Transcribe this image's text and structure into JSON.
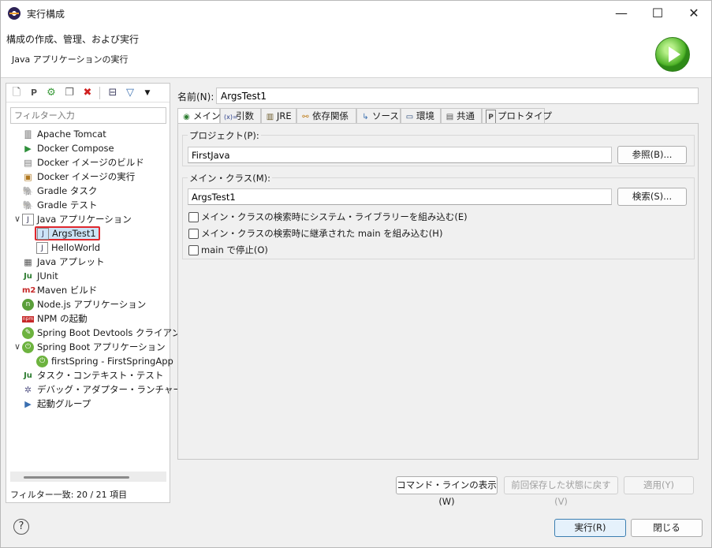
{
  "window": {
    "title": "実行構成"
  },
  "header": {
    "title": "構成の作成、管理、および実行",
    "subtitle": "Java アプリケーションの実行"
  },
  "left": {
    "filter_placeholder": "フィルター入力",
    "status": "フィルター一致: 20 / 21 項目",
    "tree": [
      {
        "label": "Apache Tomcat",
        "icon": "tomcat-icon"
      },
      {
        "label": "Docker Compose",
        "icon": "docker-compose-icon"
      },
      {
        "label": "Docker イメージのビルド",
        "icon": "docker-build-icon"
      },
      {
        "label": "Docker イメージの実行",
        "icon": "docker-run-icon"
      },
      {
        "label": "Gradle タスク",
        "icon": "gradle-icon"
      },
      {
        "label": "Gradle テスト",
        "icon": "gradle-test-icon"
      },
      {
        "label": "Java アプリケーション",
        "icon": "java-app-icon"
      },
      {
        "label": "ArgsTest1",
        "icon": "java-class-icon"
      },
      {
        "label": "HelloWorld",
        "icon": "java-class-icon"
      },
      {
        "label": "Java アプレット",
        "icon": "java-applet-icon"
      },
      {
        "label": "JUnit",
        "icon": "junit-icon"
      },
      {
        "label": "Maven ビルド",
        "icon": "maven-icon"
      },
      {
        "label": "Node.js アプリケーション",
        "icon": "nodejs-icon"
      },
      {
        "label": "NPM の起動",
        "icon": "npm-icon"
      },
      {
        "label": "Spring Boot Devtools クライアン",
        "icon": "spring-devtools-icon"
      },
      {
        "label": "Spring Boot アプリケーション",
        "icon": "spring-boot-icon"
      },
      {
        "label": "firstSpring - FirstSpringApp",
        "icon": "spring-app-icon"
      },
      {
        "label": "タスク・コンテキスト・テスト",
        "icon": "task-context-test-icon"
      },
      {
        "label": "デバッグ・アダプター・ランチャー",
        "icon": "debug-adapter-icon"
      },
      {
        "label": "起動グループ",
        "icon": "launch-group-icon"
      }
    ]
  },
  "right": {
    "name_label": "名前(N):",
    "name_value": "ArgsTest1",
    "tabs": [
      {
        "label": "メイン",
        "icon": "main-tab-icon"
      },
      {
        "label": "引数",
        "icon": "arguments-tab-icon"
      },
      {
        "label": "JRE",
        "icon": "jre-tab-icon"
      },
      {
        "label": "依存関係",
        "icon": "dependencies-tab-icon"
      },
      {
        "label": "ソース",
        "icon": "source-tab-icon"
      },
      {
        "label": "環境",
        "icon": "environment-tab-icon"
      },
      {
        "label": "共通",
        "icon": "common-tab-icon"
      },
      {
        "label": "プロトタイプ",
        "icon": "prototype-tab-icon"
      }
    ],
    "project_label": "プロジェクト(P):",
    "project_value": "FirstJava",
    "browse_button": "参照(B)...",
    "main_class_label": "メイン・クラス(M):",
    "main_class_value": "ArgsTest1",
    "search_button": "検索(S)...",
    "checks": [
      "メイン・クラスの検索時にシステム・ライブラリーを組み込む(E)",
      "メイン・クラスの検索時に継承された main を組み込む(H)",
      "main で停止(O)"
    ],
    "show_cmd_button": "コマンド・ラインの表示(W)",
    "revert_button": "前回保存した状態に戻す(V)",
    "apply_button": "適用(Y)"
  },
  "footer": {
    "run_button": "実行(R)",
    "close_button": "閉じる"
  }
}
